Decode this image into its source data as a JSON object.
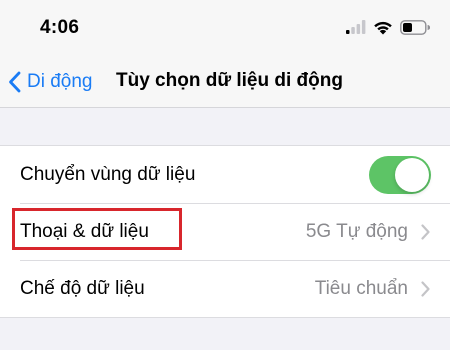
{
  "status_bar": {
    "time": "4:06",
    "icons": [
      "cellular-signal-icon",
      "wifi-icon",
      "battery-icon"
    ]
  },
  "nav": {
    "back_label": "Di động",
    "title": "Tùy chọn dữ liệu di động"
  },
  "settings": {
    "rows": [
      {
        "label": "Chuyển vùng dữ liệu",
        "control": "toggle",
        "on": true
      },
      {
        "label": "Thoại & dữ liệu",
        "value": "5G Tự động",
        "highlighted": true
      },
      {
        "label": "Chế độ dữ liệu",
        "value": "Tiêu chuẩn"
      }
    ]
  },
  "colors": {
    "accent": "#1a7cf5",
    "toggle_on": "#5dc466",
    "highlight": "#d8262c",
    "background": "#f2f2f7",
    "secondary_text": "#8a8a8e"
  }
}
